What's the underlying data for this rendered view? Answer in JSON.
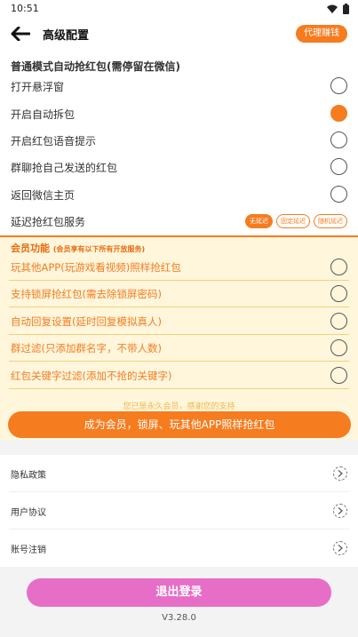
{
  "status": {
    "time": "10:51"
  },
  "header": {
    "title": "高级配置",
    "agent_button": "代理赚钱"
  },
  "normal": {
    "title": "普通模式自动抢红包(需停留在微信)",
    "items": [
      {
        "label": "打开悬浮窗",
        "checked": false
      },
      {
        "label": "开启自动拆包",
        "checked": true
      },
      {
        "label": "开启红包语音提示",
        "checked": false
      },
      {
        "label": "群聊抢自己发送的红包",
        "checked": false
      },
      {
        "label": "返回微信主页",
        "checked": false
      }
    ],
    "delay": {
      "label": "延迟抢红包服务",
      "options": [
        "无延迟",
        "固定延迟",
        "随机延迟"
      ],
      "selected": "无延迟"
    }
  },
  "member": {
    "title": "会员功能",
    "title_note": "(会员享有以下所有开放服务)",
    "items": [
      {
        "label": "玩其他APP(玩游戏看视频)照样抢红包"
      },
      {
        "label": "支持锁屏抢红包(需去除锁屏密码)"
      },
      {
        "label": "自动回复设置(延时回复模拟真人)"
      },
      {
        "label": "群过滤(只添加群名字，不带人数)"
      },
      {
        "label": "红包关键字过滤(添加不抢的关键字)"
      }
    ],
    "note": "您已是永久会员，感谢您的支持",
    "cta": "成为会员，锁屏、玩其他APP照样抢红包"
  },
  "links": [
    {
      "label": "隐私政策"
    },
    {
      "label": "用户协议"
    },
    {
      "label": "账号注销"
    }
  ],
  "logout": "退出登录",
  "version": "V3.28.0",
  "colors": {
    "accent": "#f57c1f",
    "member_bg": "#fff6dc",
    "logout": "#e66ec7"
  }
}
